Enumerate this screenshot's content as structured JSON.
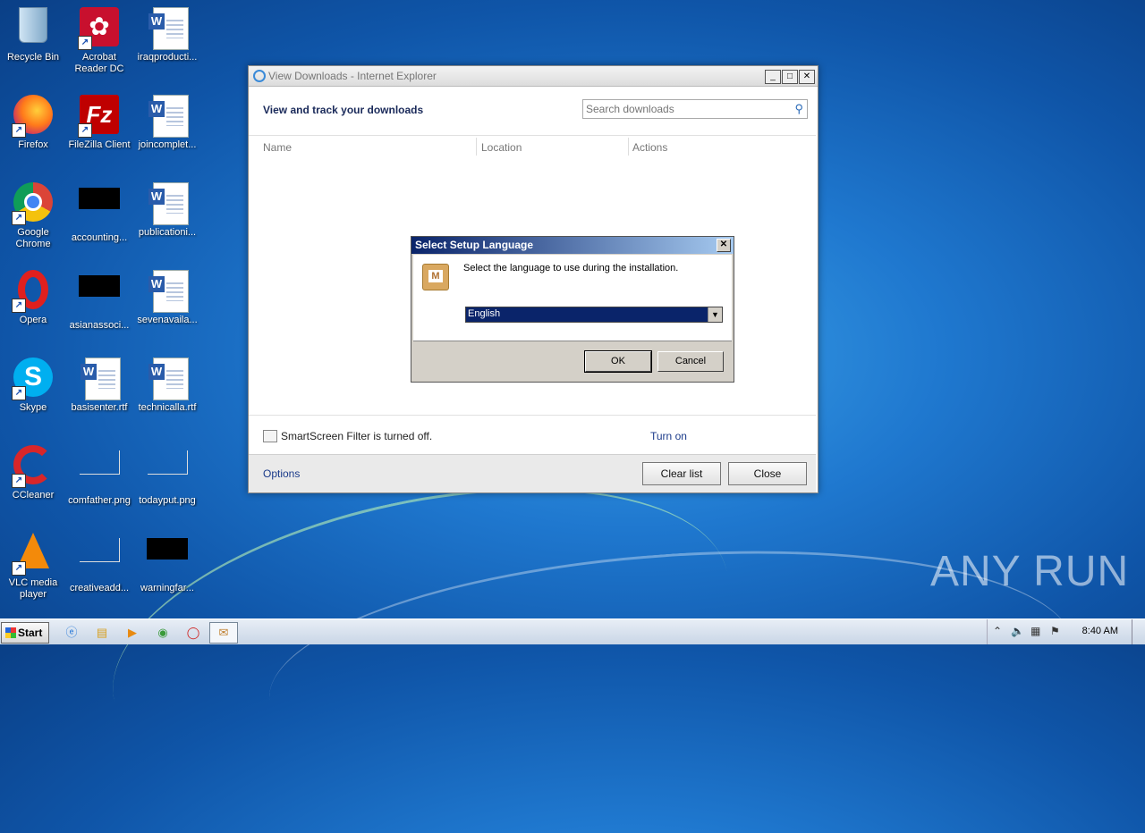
{
  "desktop": {
    "icons": [
      {
        "label": "Recycle Bin",
        "icon": "recycle-bin-icon"
      },
      {
        "label": "Acrobat Reader DC",
        "icon": "acrobat-icon"
      },
      {
        "label": "iraqproducti...",
        "icon": "word-doc-icon"
      },
      {
        "label": "Firefox",
        "icon": "firefox-icon"
      },
      {
        "label": "FileZilla Client",
        "icon": "filezilla-icon"
      },
      {
        "label": "joincomplet...",
        "icon": "word-doc-icon"
      },
      {
        "label": "Google Chrome",
        "icon": "chrome-icon"
      },
      {
        "label": "accounting...",
        "icon": "file-icon"
      },
      {
        "label": "publicationi...",
        "icon": "word-doc-icon"
      },
      {
        "label": "Opera",
        "icon": "opera-icon"
      },
      {
        "label": "asianassoci...",
        "icon": "file-icon"
      },
      {
        "label": "sevenavaila...",
        "icon": "word-doc-icon"
      },
      {
        "label": "Skype",
        "icon": "skype-icon"
      },
      {
        "label": "basisenter.rtf",
        "icon": "word-doc-icon"
      },
      {
        "label": "technicalla.rtf",
        "icon": "word-doc-icon"
      },
      {
        "label": "CCleaner",
        "icon": "ccleaner-icon"
      },
      {
        "label": "comfather.png",
        "icon": "image-file-icon"
      },
      {
        "label": "todayput.png",
        "icon": "image-file-icon"
      },
      {
        "label": "VLC media player",
        "icon": "vlc-icon"
      },
      {
        "label": "creativeadd...",
        "icon": "image-file-icon"
      },
      {
        "label": "warningfar...",
        "icon": "file-icon"
      }
    ]
  },
  "downloads_window": {
    "title": "View Downloads - Internet Explorer",
    "heading": "View and track your downloads",
    "search_placeholder": "Search downloads",
    "columns": [
      "Name",
      "Location",
      "Actions"
    ],
    "smartscreen_text": "SmartScreen Filter is turned off.",
    "turn_on": "Turn on",
    "options": "Options",
    "clear_list": "Clear list",
    "close": "Close",
    "controls": {
      "minimize": "_",
      "maximize": "□",
      "close": "✕"
    }
  },
  "setup_dialog": {
    "title": "Select Setup Language",
    "message": "Select the language to use during the installation.",
    "selected_language": "English",
    "ok": "OK",
    "cancel": "Cancel",
    "close": "✕"
  },
  "taskbar": {
    "start": "Start",
    "clock": "8:40 AM"
  },
  "watermark": "ANY RUN"
}
